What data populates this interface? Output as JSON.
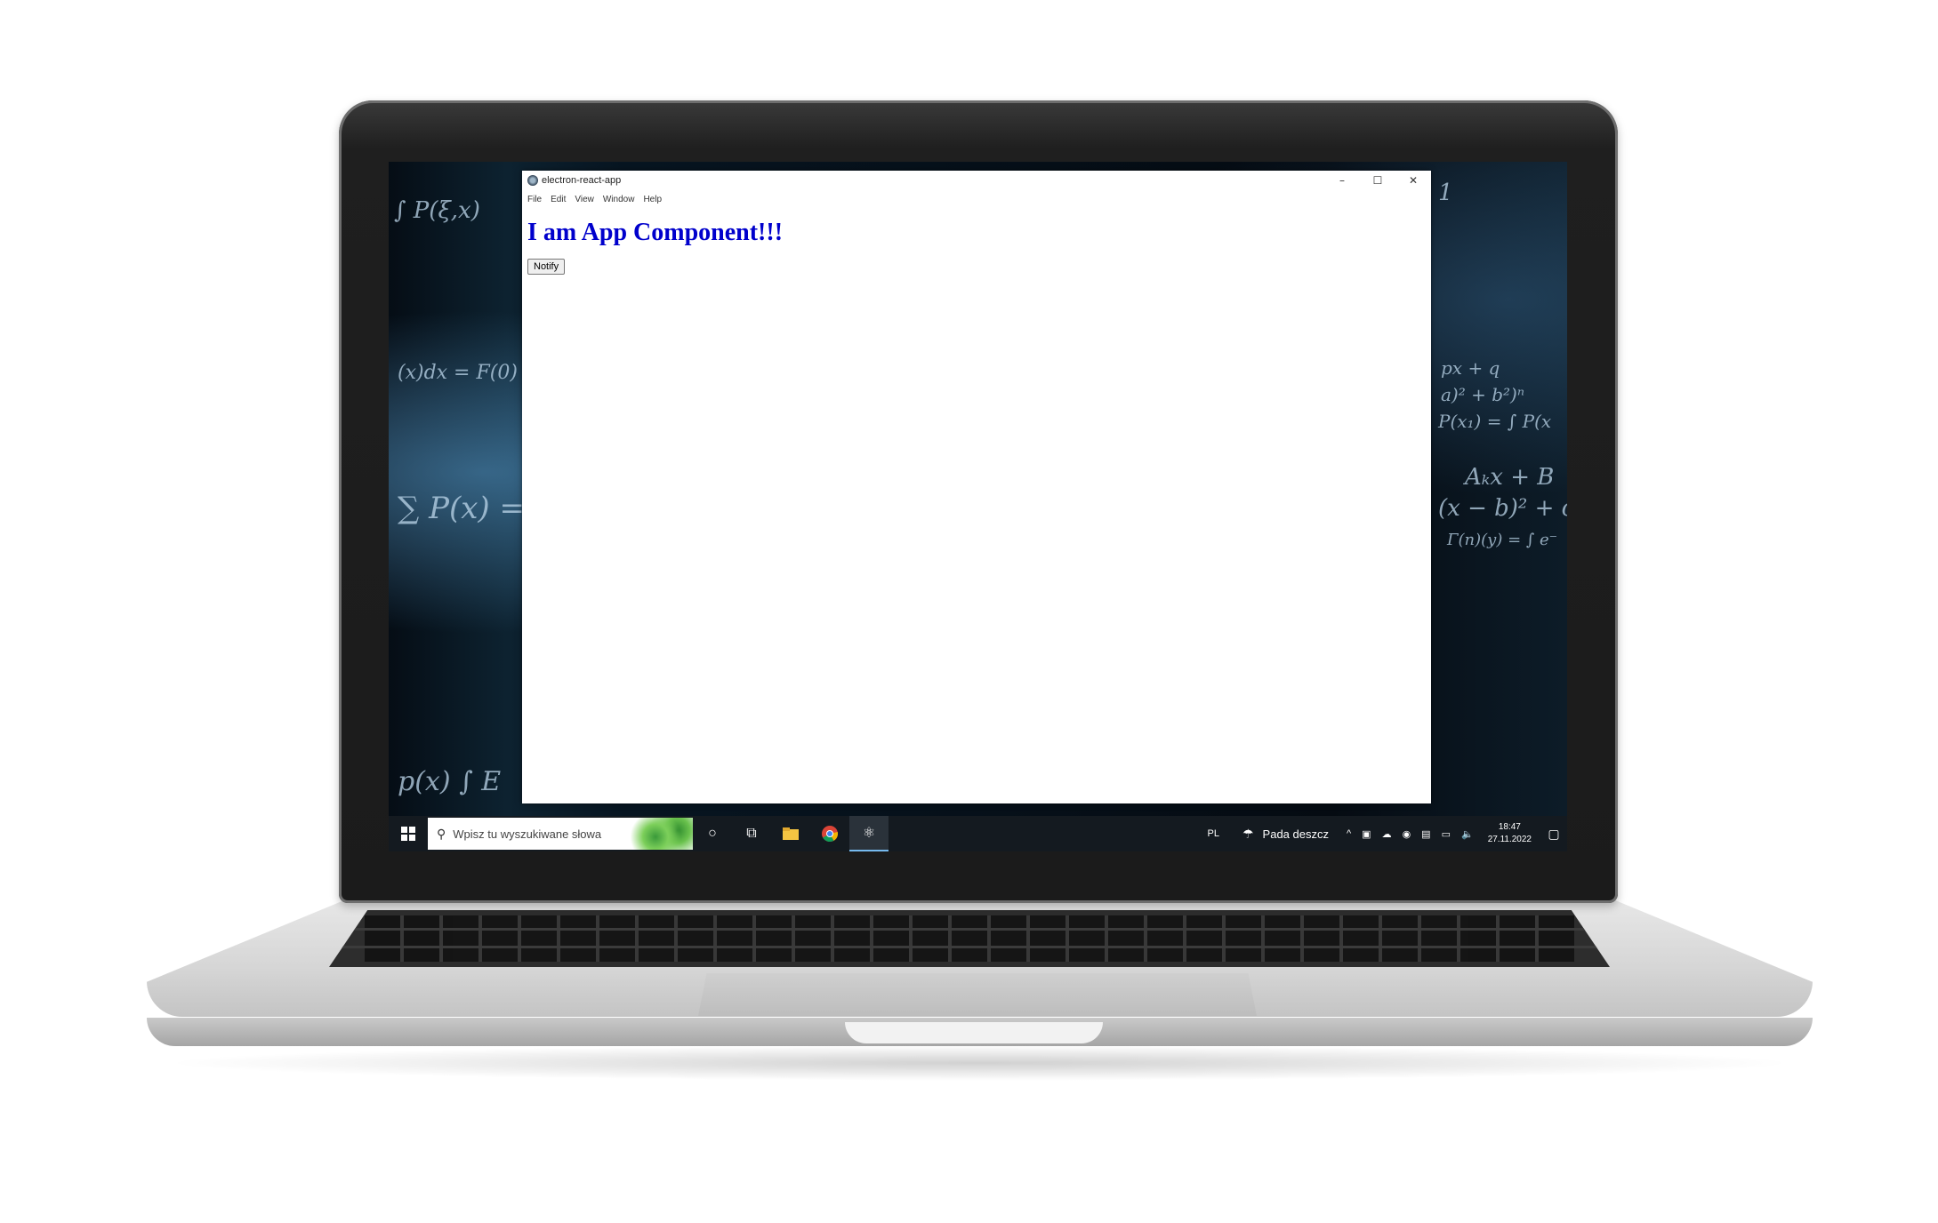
{
  "window": {
    "title": "electron-react-app",
    "controls": {
      "minimize": "–",
      "maximize": "☐",
      "close": "✕"
    },
    "menu": [
      "File",
      "Edit",
      "View",
      "Window",
      "Help"
    ]
  },
  "content": {
    "heading": "I am App Component!!!",
    "button": "Notify"
  },
  "taskbar": {
    "search_placeholder": "Wpisz tu wyszukiwane słowa",
    "language": "PL",
    "weather": "Pada deszcz",
    "time": "18:47",
    "date": "27.11.2022"
  },
  "colors": {
    "heading": "#0000cc",
    "taskbar": "#141a20"
  }
}
